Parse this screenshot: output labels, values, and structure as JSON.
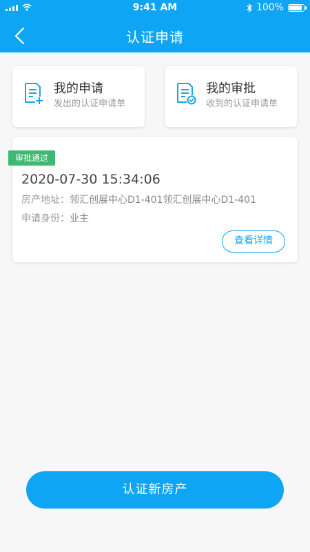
{
  "status_bar": {
    "time": "9:41 AM",
    "battery": "100%",
    "icons": [
      "signal-icon",
      "wifi-icon",
      "bluetooth-icon",
      "battery-icon"
    ]
  },
  "header": {
    "title": "认证申请",
    "back_icon": "chevron-left-icon"
  },
  "entries": [
    {
      "title": "我的申请",
      "subtitle": "发出的认证申请单",
      "icon": "document-add-icon"
    },
    {
      "title": "我的审批",
      "subtitle": "收到的认证申请单",
      "icon": "document-check-icon"
    }
  ],
  "record": {
    "status": "审批通过",
    "datetime": "2020-07-30 15:34:06",
    "address_label": "房产地址：",
    "address_value": "领汇创展中心D1-401领汇创展中心D1-401",
    "identity_label": "申请身份：",
    "identity_value": "业主",
    "detail_button": "查看详情"
  },
  "primary_action": "认证新房产",
  "colors": {
    "primary": "#0ea5f4",
    "success": "#3fb872",
    "background": "#f7f7f7"
  }
}
